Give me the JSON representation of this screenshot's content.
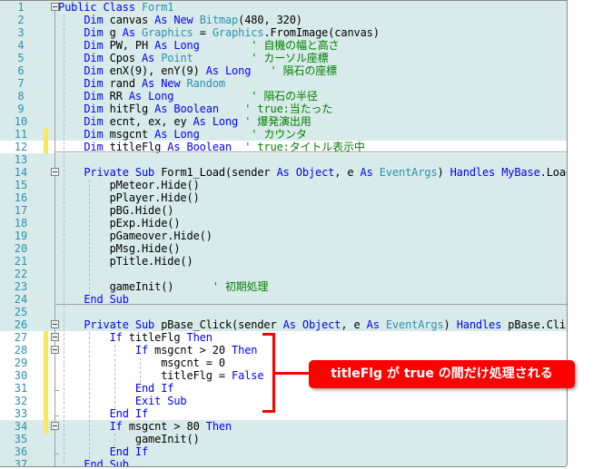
{
  "editor": {
    "language": "Visual Basic",
    "highlighted_lines": [
      12,
      27,
      28,
      29,
      30,
      31,
      32,
      33
    ],
    "changed_lines": [
      11,
      12,
      27,
      28,
      29,
      30,
      31,
      32,
      33,
      34
    ],
    "lines": [
      {
        "n": "1",
        "html": "<span class='kw'>Public Class</span> <span class='ty'>Form1</span>"
      },
      {
        "n": "2",
        "html": "    <span class='kw'>Dim</span> canvas <span class='kw'>As New</span> <span class='ty'>Bitmap</span>(480, 320)"
      },
      {
        "n": "3",
        "html": "    <span class='kw'>Dim</span> g <span class='kw'>As</span> <span class='ty'>Graphics</span> = <span class='ty'>Graphics</span>.FromImage(canvas)"
      },
      {
        "n": "4",
        "html": "    <span class='kw'>Dim</span> PW, PH <span class='kw'>As Long</span>        <span class='cm'>' 自機の幅と高さ</span>"
      },
      {
        "n": "5",
        "html": "    <span class='kw'>Dim</span> Cpos <span class='kw'>As</span> <span class='ty'>Point</span>         <span class='cm'>' カーソル座標</span>"
      },
      {
        "n": "6",
        "html": "    <span class='kw'>Dim</span> enX(9), enY(9) <span class='kw'>As Long</span>   <span class='cm'>' 隕石の座標</span>"
      },
      {
        "n": "7",
        "html": "    <span class='kw'>Dim</span> rand <span class='kw'>As New</span> <span class='ty'>Random</span>"
      },
      {
        "n": "8",
        "html": "    <span class='kw'>Dim</span> RR <span class='kw'>As Long</span>            <span class='cm'>' 隕石の半径</span>"
      },
      {
        "n": "9",
        "html": "    <span class='kw'>Dim</span> hitFlg <span class='kw'>As Boolean</span>    <span class='cm'>' true:当たった</span>"
      },
      {
        "n": "10",
        "html": "    <span class='kw'>Dim</span> ecnt, ex, ey <span class='kw'>As Long</span> <span class='cm'>' 爆発演出用</span>"
      },
      {
        "n": "11",
        "html": "    <span class='kw'>Dim</span> msgcnt <span class='kw'>As Long</span>        <span class='cm'>' カウンタ</span>"
      },
      {
        "n": "12",
        "html": "    <span class='kw'>Dim</span> titleFlg <span class='kw'>As Boolean</span>  <span class='cm'>' true:タイトル表示中</span>"
      },
      {
        "n": "13",
        "html": ""
      },
      {
        "n": "14",
        "html": "    <span class='kw'>Private Sub</span> Form1_Load(sender <span class='kw'>As Object</span>, e <span class='kw'>As</span> <span class='ty'>EventArgs</span>) <span class='kw'>Handles MyBase</span>.Load"
      },
      {
        "n": "15",
        "html": "        pMeteor.Hide()"
      },
      {
        "n": "16",
        "html": "        pPlayer.Hide()"
      },
      {
        "n": "17",
        "html": "        pBG.Hide()"
      },
      {
        "n": "18",
        "html": "        pExp.Hide()"
      },
      {
        "n": "19",
        "html": "        pGameover.Hide()"
      },
      {
        "n": "20",
        "html": "        pMsg.Hide()"
      },
      {
        "n": "21",
        "html": "        pTitle.Hide()"
      },
      {
        "n": "22",
        "html": ""
      },
      {
        "n": "23",
        "html": "        gameInit()      <span class='cm'>' 初期処理</span>"
      },
      {
        "n": "24",
        "html": "    <span class='kw'>End Sub</span>"
      },
      {
        "n": "25",
        "html": ""
      },
      {
        "n": "26",
        "html": "    <span class='kw'>Private Sub</span> pBase_Click(sender <span class='kw'>As Object</span>, e <span class='kw'>As</span> <span class='ty'>EventArgs</span>) <span class='kw'>Handles</span> pBase.Clic"
      },
      {
        "n": "27",
        "html": "        <span class='kw'>If</span> titleFlg <span class='kw'>Then</span>"
      },
      {
        "n": "28",
        "html": "            <span class='kw'>If</span> msgcnt &gt; 20 <span class='kw'>Then</span>"
      },
      {
        "n": "29",
        "html": "                msgcnt = 0"
      },
      {
        "n": "30",
        "html": "                titleFlg = <span class='kw'>False</span>"
      },
      {
        "n": "31",
        "html": "            <span class='kw'>End If</span>"
      },
      {
        "n": "32",
        "html": "            <span class='kw'>Exit Sub</span>"
      },
      {
        "n": "33",
        "html": "        <span class='kw'>End If</span>"
      },
      {
        "n": "34",
        "html": "        <span class='kw'>If</span> msgcnt &gt; 80 <span class='kw'>Then</span>"
      },
      {
        "n": "35",
        "html": "            gameInit()"
      },
      {
        "n": "36",
        "html": "        <span class='kw'>End If</span>"
      },
      {
        "n": "37",
        "html": "    <span class='kw'>End Sub</span>"
      }
    ]
  },
  "annotation": {
    "callout_text": "titleFlg が true の間だけ処理される",
    "accent_color": "#ff0000"
  }
}
